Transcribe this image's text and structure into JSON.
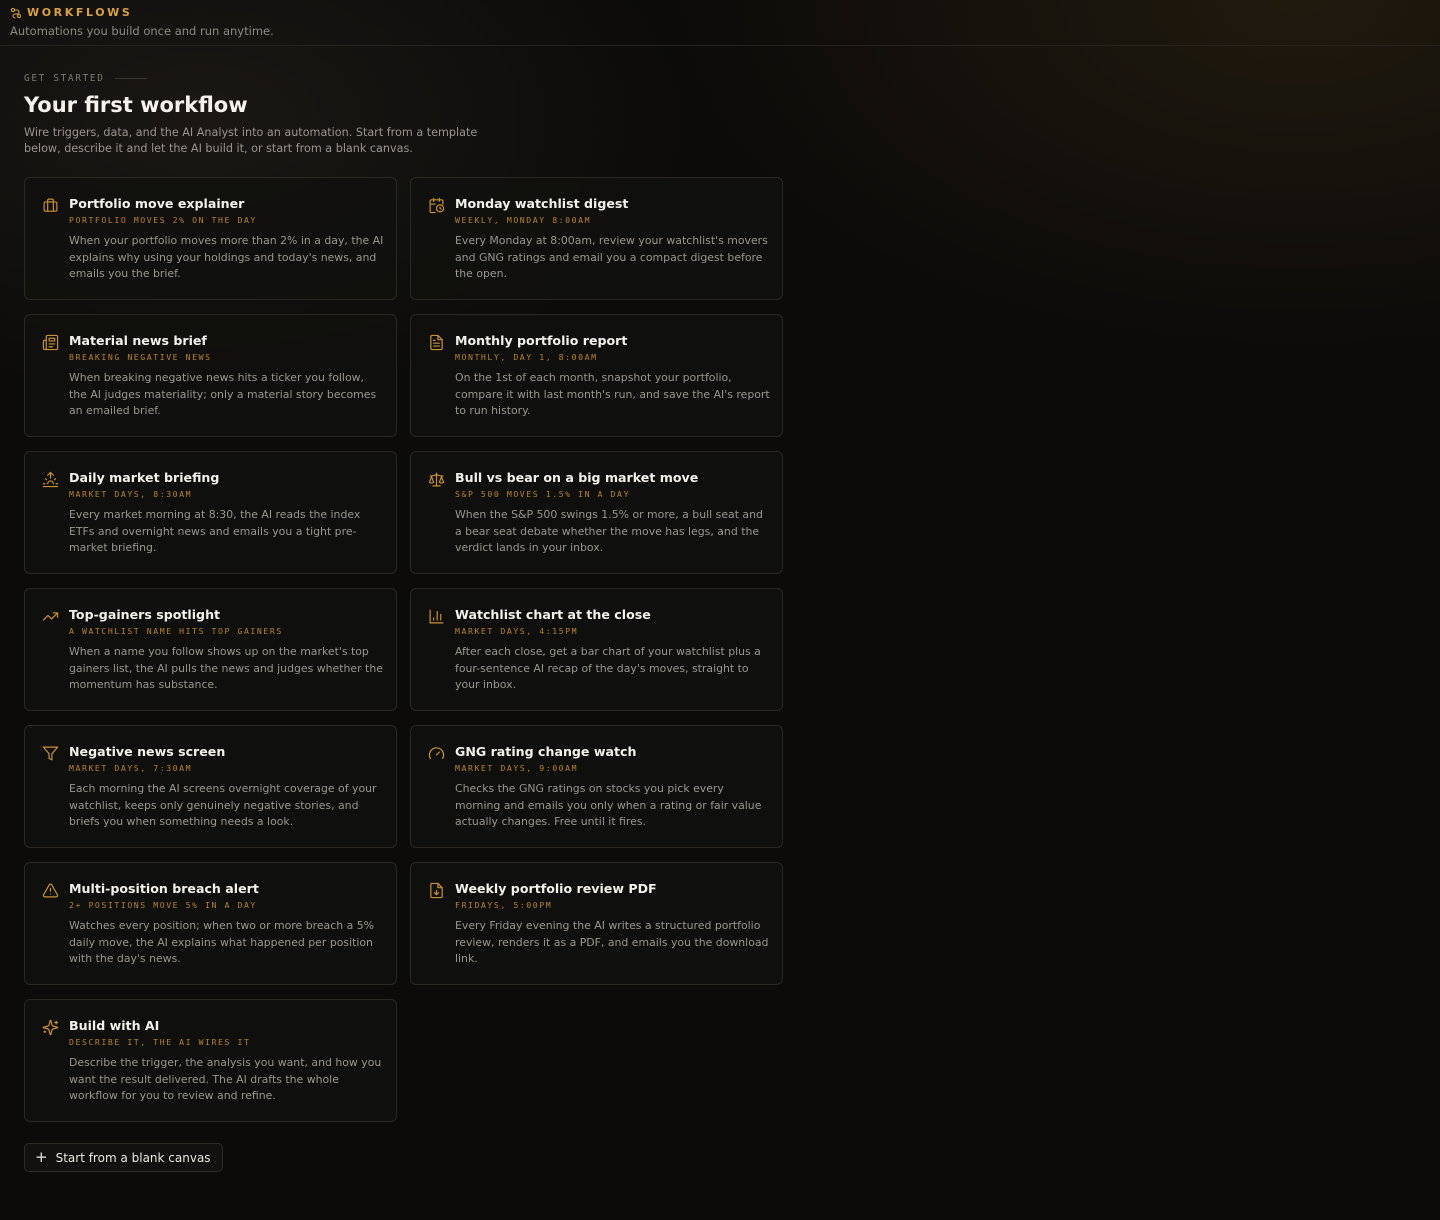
{
  "header": {
    "section_label": "WORKFLOWS",
    "subtitle": "Automations you build once and run anytime."
  },
  "intro": {
    "eyebrow": "GET STARTED",
    "title": "Your first workflow",
    "description": "Wire triggers, data, and the AI Analyst into an automation. Start from a template below, describe it and let the AI build it, or start from a blank canvas."
  },
  "templates": [
    {
      "icon": "briefcase-icon",
      "title": "Portfolio move explainer",
      "trigger": "Portfolio moves 2% on the day",
      "description": "When your portfolio moves more than 2% in a day, the AI explains why using your holdings and today's news, and emails you the brief."
    },
    {
      "icon": "calendar-clock-icon",
      "title": "Monday watchlist digest",
      "trigger": "Weekly, Monday 8:00am",
      "description": "Every Monday at 8:00am, review your watchlist's movers and GNG ratings and email you a compact digest before the open."
    },
    {
      "icon": "newspaper-icon",
      "title": "Material news brief",
      "trigger": "Breaking negative news",
      "description": "When breaking negative news hits a ticker you follow, the AI judges materiality; only a material story becomes an emailed brief."
    },
    {
      "icon": "file-text-icon",
      "title": "Monthly portfolio report",
      "trigger": "Monthly, day 1, 8:00am",
      "description": "On the 1st of each month, snapshot your portfolio, compare it with last month's run, and save the AI's report to run history."
    },
    {
      "icon": "sunrise-icon",
      "title": "Daily market briefing",
      "trigger": "Market days, 8:30am",
      "description": "Every market morning at 8:30, the AI reads the index ETFs and overnight news and emails you a tight pre-market briefing."
    },
    {
      "icon": "scale-icon",
      "title": "Bull vs bear on a big market move",
      "trigger": "S&P 500 moves 1.5% in a day",
      "description": "When the S&P 500 swings 1.5% or more, a bull seat and a bear seat debate whether the move has legs, and the verdict lands in your inbox."
    },
    {
      "icon": "trending-up-icon",
      "title": "Top-gainers spotlight",
      "trigger": "A watchlist name hits top gainers",
      "description": "When a name you follow shows up on the market's top gainers list, the AI pulls the news and judges whether the momentum has substance."
    },
    {
      "icon": "bar-chart-icon",
      "title": "Watchlist chart at the close",
      "trigger": "Market days, 4:15pm",
      "description": "After each close, get a bar chart of your watchlist plus a four-sentence AI recap of the day's moves, straight to your inbox."
    },
    {
      "icon": "filter-icon",
      "title": "Negative news screen",
      "trigger": "Market days, 7:30am",
      "description": "Each morning the AI screens overnight coverage of your watchlist, keeps only genuinely negative stories, and briefs you when something needs a look."
    },
    {
      "icon": "gauge-icon",
      "title": "GNG rating change watch",
      "trigger": "Market days, 9:00am",
      "description": "Checks the GNG ratings on stocks you pick every morning and emails you only when a rating or fair value actually changes. Free until it fires."
    },
    {
      "icon": "alert-triangle-icon",
      "title": "Multi-position breach alert",
      "trigger": "2+ positions move 5% in a day",
      "description": "Watches every position; when two or more breach a 5% daily move, the AI explains what happened per position with the day's news."
    },
    {
      "icon": "file-download-icon",
      "title": "Weekly portfolio review PDF",
      "trigger": "Fridays, 5:00pm",
      "description": "Every Friday evening the AI writes a structured portfolio review, renders it as a PDF, and emails you the download link."
    },
    {
      "icon": "sparkles-icon",
      "title": "Build with AI",
      "trigger": "Describe it, the AI wires it",
      "description": "Describe the trigger, the analysis you want, and how you want the result delivered. The AI drafts the whole workflow for you to review and refine."
    }
  ],
  "blank_button": {
    "icon": "plus-icon",
    "label": "Start from a blank canvas"
  },
  "colors": {
    "accent": "#d9a23a",
    "background": "#0c0b0a",
    "card_border": "#2b2824"
  }
}
